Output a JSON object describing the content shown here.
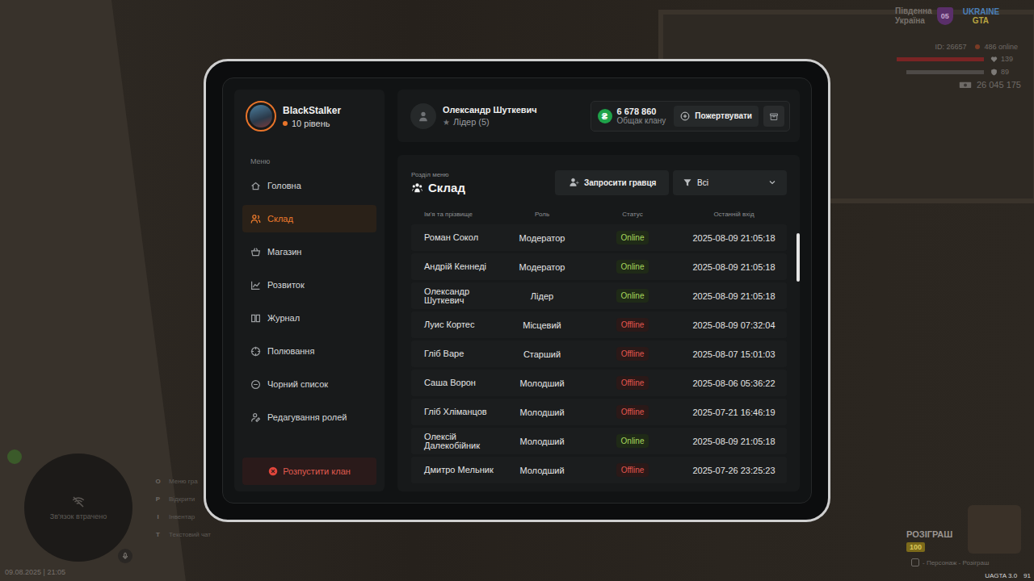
{
  "hud": {
    "server": {
      "name_lines": [
        "Південна",
        "Україна"
      ],
      "region_badge": "05",
      "logo_lines": [
        "UKRAINE",
        "GTA"
      ]
    },
    "player": {
      "id": "ID: 26657",
      "online": "486 online",
      "health": {
        "value": "139",
        "level": 1
      },
      "armor": {
        "value": "89",
        "level": 1
      },
      "money": "26 045 175"
    },
    "minimap": {
      "status": "Зв'язок втрачено"
    },
    "clock": "09.08.2025 | 21:05",
    "hotkeys": [
      {
        "key": "O",
        "label": "Меню гра"
      },
      {
        "key": "P",
        "label": "Відкрити"
      },
      {
        "key": "I",
        "label": "Інвентар"
      },
      {
        "key": "T",
        "label": "Текстовий чат"
      }
    ],
    "giveaway": {
      "title": "РОЗІГРАШ",
      "count": "100",
      "caption": "- Персонаж - Розіграш"
    },
    "version": "UAGTA 3.0",
    "fps": "91"
  },
  "sidebar": {
    "profile": {
      "name": "BlackStalker",
      "level": "10 рівень"
    },
    "menu_label": "Меню",
    "items": [
      {
        "label": "Головна",
        "selected": false
      },
      {
        "label": "Склад",
        "selected": true
      },
      {
        "label": "Магазин",
        "selected": false
      },
      {
        "label": "Розвиток",
        "selected": false
      },
      {
        "label": "Журнал",
        "selected": false
      },
      {
        "label": "Полювання",
        "selected": false
      },
      {
        "label": "Чорний список",
        "selected": false
      },
      {
        "label": "Редагування ролей",
        "selected": false
      }
    ],
    "disband_button": "Розпустити клан"
  },
  "header": {
    "member": {
      "name": "Олександр Шуткевич",
      "star": "★",
      "rank": "Лідер (5)"
    },
    "treasury": {
      "currency_icon": "₴",
      "amount": "6 678 860",
      "label": "Общак клану"
    },
    "donate_button": "Пожертвувати"
  },
  "panel": {
    "caption": "Розділ меню",
    "title": "Склад",
    "invite_button": "Запросити гравця",
    "filter": "Всі"
  },
  "table": {
    "columns": [
      "Ім'я та прізвище",
      "Роль",
      "Статус",
      "Останній вхід"
    ],
    "rows": [
      {
        "name": "Роман Сокол",
        "role": "Модератор",
        "status": "Online",
        "online": true,
        "last_login": "2025-08-09 21:05:18"
      },
      {
        "name": "Андрій Кеннеді",
        "role": "Модератор",
        "status": "Online",
        "online": true,
        "last_login": "2025-08-09 21:05:18"
      },
      {
        "name": "Олександр Шуткевич",
        "role": "Лідер",
        "status": "Online",
        "online": true,
        "last_login": "2025-08-09 21:05:18"
      },
      {
        "name": "Луис Кортес",
        "role": "Місцевий",
        "status": "Offline",
        "online": false,
        "last_login": "2025-08-09 07:32:04"
      },
      {
        "name": "Гліб Варе",
        "role": "Старший",
        "status": "Offline",
        "online": false,
        "last_login": "2025-08-07 15:01:03"
      },
      {
        "name": "Саша Ворон",
        "role": "Молодший",
        "status": "Offline",
        "online": false,
        "last_login": "2025-08-06 05:36:22"
      },
      {
        "name": "Гліб Хліманцов",
        "role": "Молодший",
        "status": "Offline",
        "online": false,
        "last_login": "2025-07-21 16:46:19"
      },
      {
        "name": "Олексій Далекобійник",
        "role": "Молодший",
        "status": "Online",
        "online": true,
        "last_login": "2025-08-09 21:05:18"
      },
      {
        "name": "Дмитро Мельник",
        "role": "Молодший",
        "status": "Offline",
        "online": false,
        "last_login": "2025-07-26 23:25:23"
      }
    ]
  }
}
